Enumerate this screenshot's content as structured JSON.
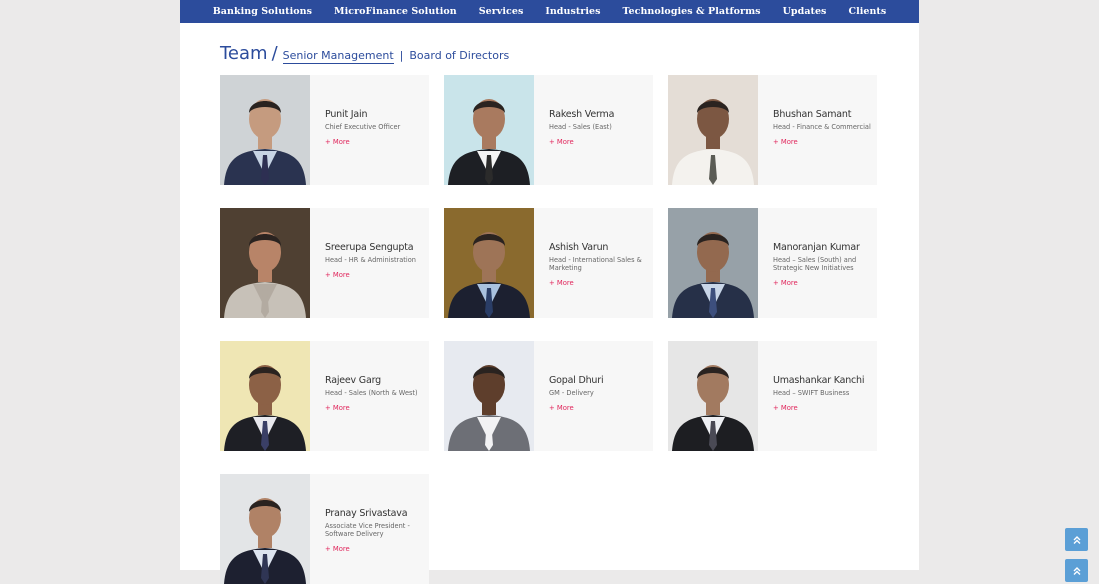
{
  "nav": {
    "items": [
      "Banking Solutions",
      "MicroFinance Solution",
      "Services",
      "Industries",
      "Technologies & Platforms",
      "Updates",
      "Clients"
    ]
  },
  "heading": {
    "title": "Team",
    "slash": "/",
    "tab_active": "Senior Management",
    "separator": "|",
    "tab_other": "Board of Directors"
  },
  "more_label": "+ More",
  "members": [
    {
      "name": "Punit Jain",
      "role": "Chief Executive Officer",
      "bg": "#cfd3d6",
      "suit": "#2a3350",
      "shirt": "#c7d4e4",
      "tie": "#2d2f52",
      "skin": "#c59b7f"
    },
    {
      "name": "Rakesh Verma",
      "role": "Head - Sales (East)",
      "bg": "#c9e4ea",
      "suit": "#1d1f24",
      "shirt": "#f4f4f4",
      "tie": "#2b2b2b",
      "skin": "#a97a5f"
    },
    {
      "name": "Bhushan Samant",
      "role": "Head - Finance & Commercial",
      "bg": "#e4ddd6",
      "suit": "#f4f2ee",
      "shirt": "#f4f2ee",
      "tie": "#5b5c55",
      "skin": "#7c5742"
    },
    {
      "name": "Sreerupa Sengupta",
      "role": "Head - HR & Administration",
      "bg": "#4f4032",
      "suit": "#c7c1b8",
      "shirt": "#b3aba1",
      "tie": "#b3aba1",
      "skin": "#b88468"
    },
    {
      "name": "Ashish Varun",
      "role": "Head - International Sales & Marketing",
      "bg": "#8a6a2e",
      "suit": "#1c2030",
      "shirt": "#a9c1de",
      "tie": "#2a3d66",
      "skin": "#9e7457"
    },
    {
      "name": "Manoranjan Kumar",
      "role": "Head – Sales (South) and Strategic New Initiatives",
      "bg": "#97a1a8",
      "suit": "#263048",
      "shirt": "#c9d6e8",
      "tie": "#3d4f7d",
      "skin": "#93694f"
    },
    {
      "name": "Rajeev Garg",
      "role": "Head - Sales (North & West)",
      "bg": "#efe6b4",
      "suit": "#1e1f25",
      "shirt": "#e9e9ee",
      "tie": "#3a3f66",
      "skin": "#8c6146"
    },
    {
      "name": "Gopal Dhuri",
      "role": "GM - Delivery",
      "bg": "#e7eaf0",
      "suit": "#6d6f76",
      "shirt": "#f2f2f4",
      "tie": "#f2f2f4",
      "skin": "#5e3e2c"
    },
    {
      "name": "Umashankar Kanchi",
      "role": "Head – SWIFT Business",
      "bg": "#e6e6e6",
      "suit": "#1d1e22",
      "shirt": "#eef0f4",
      "tie": "#4a4a55",
      "skin": "#a27a60"
    },
    {
      "name": "Pranay Srivastava",
      "role": "Associate Vice President - Software Delivery",
      "bg": "#e3e5e7",
      "suit": "#1d2030",
      "shirt": "#dde4ef",
      "tie": "#2f3554",
      "skin": "#b08266"
    }
  ],
  "colors": {
    "nav_bg": "#2c4c9c",
    "accent": "#e0255b",
    "scroll_btn": "#5b9fd6"
  },
  "icons": {
    "scroll_top": "double-chevron-up-icon"
  }
}
